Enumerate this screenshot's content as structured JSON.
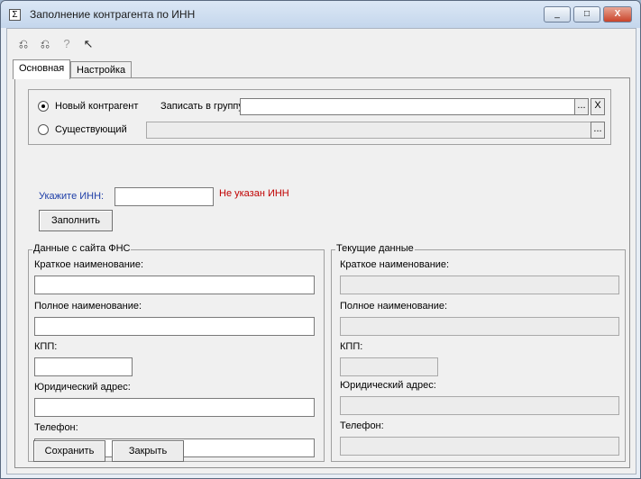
{
  "window": {
    "title": "Заполнение контрагента по ИНН",
    "minimize": "_",
    "maximize": "□",
    "close": "X"
  },
  "tabs": [
    "Основная",
    "Настройка"
  ],
  "mode": {
    "new_label": "Новый контрагент",
    "existing_label": "Существующий",
    "group_label": "Записать в группу:",
    "group_value": "",
    "existing_value": "",
    "browse": "...",
    "clear": "X",
    "selected": "new"
  },
  "inn": {
    "label": "Укажите ИНН:",
    "value": "",
    "error": "Не указан ИНН",
    "fill_button": "Заполнить"
  },
  "fns": {
    "title": "Данные с сайта ФНС",
    "short_name_label": "Краткое наименование:",
    "short_name": "",
    "full_name_label": "Полное наименование:",
    "full_name": "",
    "kpp_label": "КПП:",
    "kpp": "",
    "address_label": "Юридический адрес:",
    "address": "",
    "phone_label": "Телефон:",
    "phone": ""
  },
  "current": {
    "title": "Текущие данные",
    "short_name_label": "Краткое наименование:",
    "short_name": "",
    "full_name_label": "Полное наименование:",
    "full_name": "",
    "kpp_label": "КПП:",
    "kpp": "",
    "address_label": "Юридический адрес:",
    "address": "",
    "phone_label": "Телефон:",
    "phone": ""
  },
  "buttons": {
    "save": "Сохранить",
    "close": "Закрыть"
  },
  "colors": {
    "inn_label": "#1f3fa8",
    "error": "#c00000"
  }
}
